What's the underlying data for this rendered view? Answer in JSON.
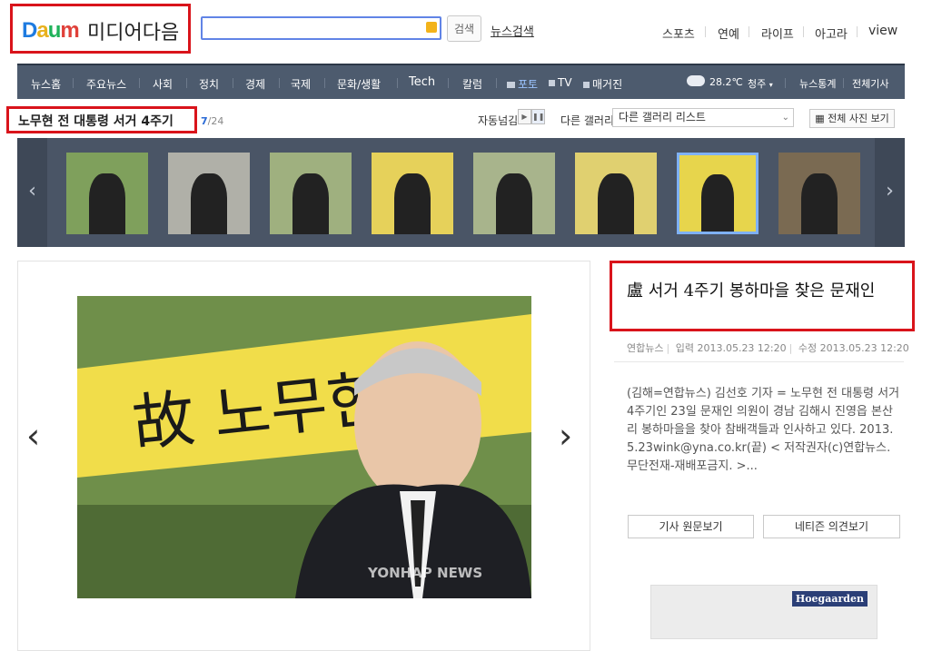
{
  "header": {
    "logo_letters": [
      "D",
      "a",
      "u",
      "m"
    ],
    "logo_text": "미디어다음",
    "search_placeholder": "",
    "search_button": "검색",
    "news_search": "뉴스검색",
    "top_links": [
      "스포츠",
      "연예",
      "라이프",
      "아고라",
      "view"
    ]
  },
  "nav": {
    "items": [
      "뉴스홈",
      "주요뉴스",
      "사회",
      "정치",
      "경제",
      "국제",
      "문화/생활",
      "Tech",
      "칼럼"
    ],
    "photo": "포토",
    "tv": "TV",
    "magazine": "매거진",
    "weather_temp": "28.2℃",
    "weather_city": "청주",
    "right_links": [
      "뉴스통계",
      "전체기사"
    ]
  },
  "gallery": {
    "title": "노무현 전 대통령 서거 4주기",
    "current": "7",
    "total": "/24",
    "autoplay_label": "자동넘김",
    "other_gallery_label": "다른 갤러리",
    "select_value": "다른 갤러리 리스트",
    "all_photos": "전체 사진 보기",
    "selected_index": 6,
    "thumbs": [
      {
        "name": "thumb-1",
        "bg": "#7fa05c"
      },
      {
        "name": "thumb-2",
        "bg": "#b0b0a8"
      },
      {
        "name": "thumb-3",
        "bg": "#9fb07f"
      },
      {
        "name": "thumb-4",
        "bg": "#e6d15a"
      },
      {
        "name": "thumb-5",
        "bg": "#a8b48c"
      },
      {
        "name": "thumb-6",
        "bg": "#e0d070"
      },
      {
        "name": "thumb-7",
        "bg": "#e7d54c"
      },
      {
        "name": "thumb-8",
        "bg": "#7a6a52"
      }
    ]
  },
  "photo": {
    "banner_text": "故 노무현",
    "watermark": "YONHAP NEWS",
    "prev_glyph": "‹",
    "next_glyph": "›"
  },
  "article": {
    "headline": "盧 서거 4주기 봉하마을 찾은 문재인",
    "source": "연합뉴스",
    "input_label": "입력",
    "input_time": "2013.05.23 12:20",
    "edit_label": "수정",
    "edit_time": "2013.05.23 12:20",
    "body": "(김해=연합뉴스) 김선호 기자 = 노무현 전 대통령 서거 4주기인 23일 문재인 의원이 경남 김해시 진영읍 본산리 봉하마을을 찾아 참배객들과 인사하고 있다. 2013.5.23wink@yna.co.kr(끝) < 저작권자(c)연합뉴스. 무단전재-재배포금지. >...",
    "btn_original": "기사 원문보기",
    "btn_comments": "네티즌 의견보기"
  },
  "ad": {
    "brand": "Hoegaarden"
  }
}
